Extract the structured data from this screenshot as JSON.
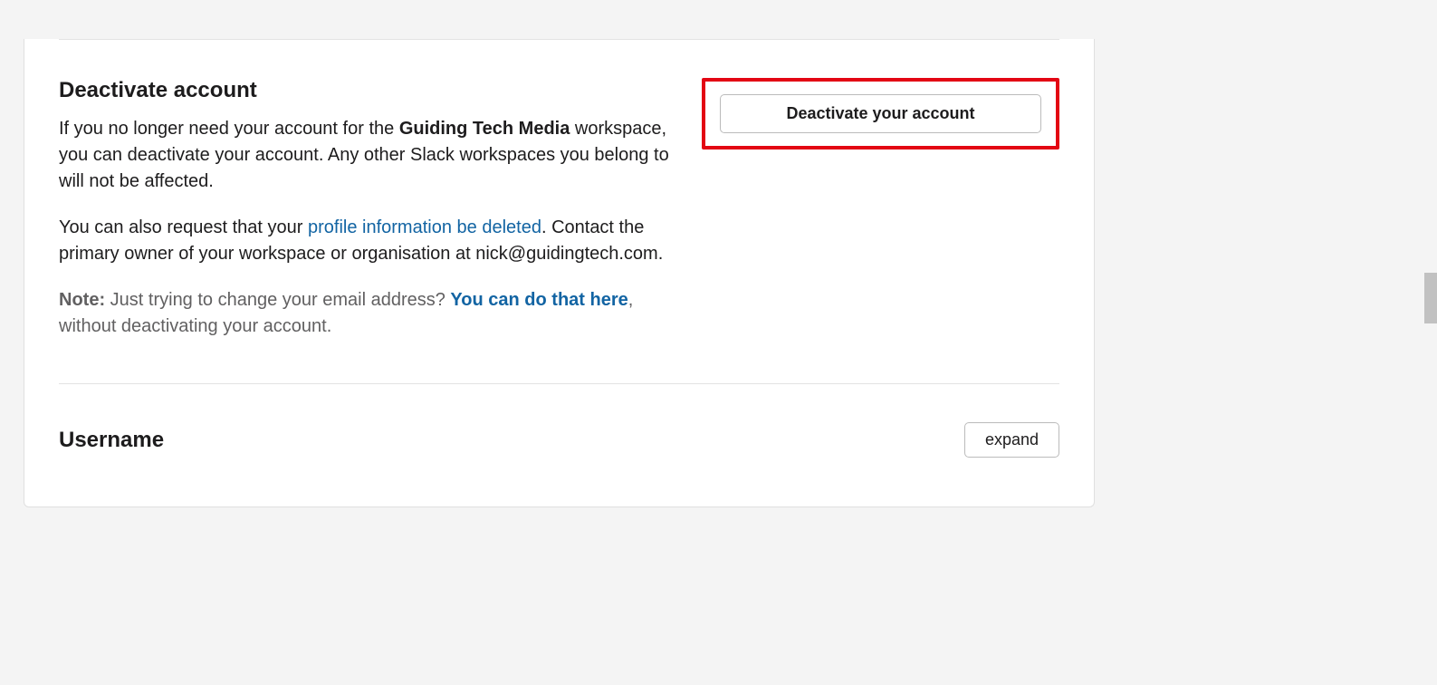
{
  "deactivate": {
    "title": "Deactivate account",
    "p1_prefix": "If you no longer need your account for the ",
    "p1_bold": "Guiding Tech Media",
    "p1_suffix": " workspace, you can deactivate your account. Any other Slack workspaces you belong to will not be affected.",
    "p2_prefix": "You can also request that your ",
    "p2_link": "profile information be deleted",
    "p2_suffix": ". Contact the primary owner of your workspace or organisation at nick@guidingtech.com.",
    "note_label": "Note:",
    "note_prefix": " Just trying to change your email address? ",
    "note_link": "You can do that here",
    "note_suffix": ", without deactivating your account.",
    "button_label": "Deactivate your account"
  },
  "username": {
    "title": "Username",
    "expand_label": "expand"
  }
}
